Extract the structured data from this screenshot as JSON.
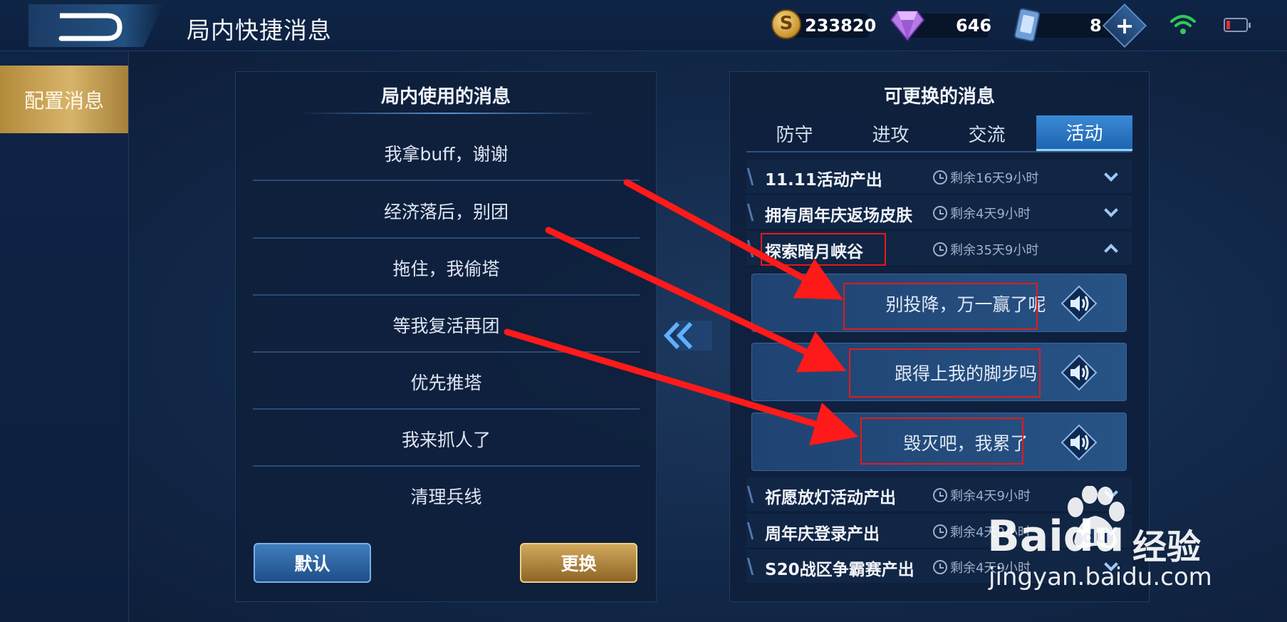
{
  "header": {
    "title": "局内快捷消息",
    "resources": {
      "coins": "233820",
      "coin_symbol": "S",
      "diamonds": "646",
      "cards": "8"
    }
  },
  "sidebar": {
    "items": [
      {
        "label": "配置消息",
        "active": true
      }
    ]
  },
  "in_game_panel": {
    "title": "局内使用的消息",
    "messages": [
      "我拿buff，谢谢",
      "经济落后，别团",
      "拖住，我偷塔",
      "等我复活再团",
      "优先推塔",
      "我来抓人了",
      "清理兵线"
    ],
    "default_label": "默认",
    "replace_label": "更换"
  },
  "replaceable_panel": {
    "title": "可更换的消息",
    "tabs": [
      {
        "label": "防守",
        "active": false
      },
      {
        "label": "进攻",
        "active": false
      },
      {
        "label": "交流",
        "active": false
      },
      {
        "label": "活动",
        "active": true
      }
    ],
    "categories_top": [
      {
        "name": "11.11活动产出",
        "time": "剩余16天9小时",
        "expanded": false
      },
      {
        "name": "拥有周年庆返场皮肤",
        "time": "剩余4天9小时",
        "expanded": false
      },
      {
        "name": "探索暗月峡谷",
        "time": "剩余35天9小时",
        "expanded": true
      }
    ],
    "voice_lines": [
      "别投降，万一赢了呢",
      "跟得上我的脚步吗",
      "毁灭吧，我累了"
    ],
    "categories_bottom": [
      {
        "name": "祈愿放灯活动产出",
        "time": "剩余4天9小时",
        "expanded": false
      },
      {
        "name": "周年庆登录产出",
        "time": "剩余4天9小时",
        "expanded": false
      },
      {
        "name": "S20战区争霸赛产出",
        "time": "剩余4天9小时",
        "expanded": false
      }
    ]
  },
  "watermark": {
    "brand": "Baidu",
    "cn": "经验",
    "url": "jingyan.baidu.com"
  },
  "colors": {
    "annotation_red": "#e21b1b",
    "active_tab": "#2f7bc8",
    "gold": "#c9a45a"
  }
}
